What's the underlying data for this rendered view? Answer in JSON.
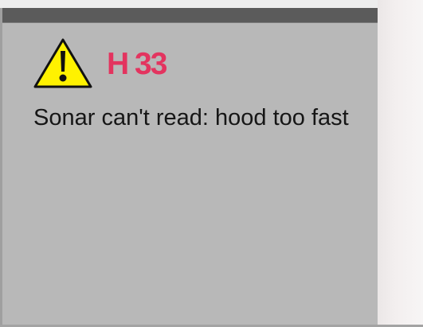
{
  "notification": {
    "icon": "warning-triangle-icon",
    "code": "H 33",
    "message": "Sonar can't read: hood too fast"
  },
  "colors": {
    "panel_background": "#b8b8b8",
    "header_bar": "#5b5b5b",
    "code_text": "#e3345f",
    "message_text": "#161616",
    "warning_fill": "#fff200"
  }
}
